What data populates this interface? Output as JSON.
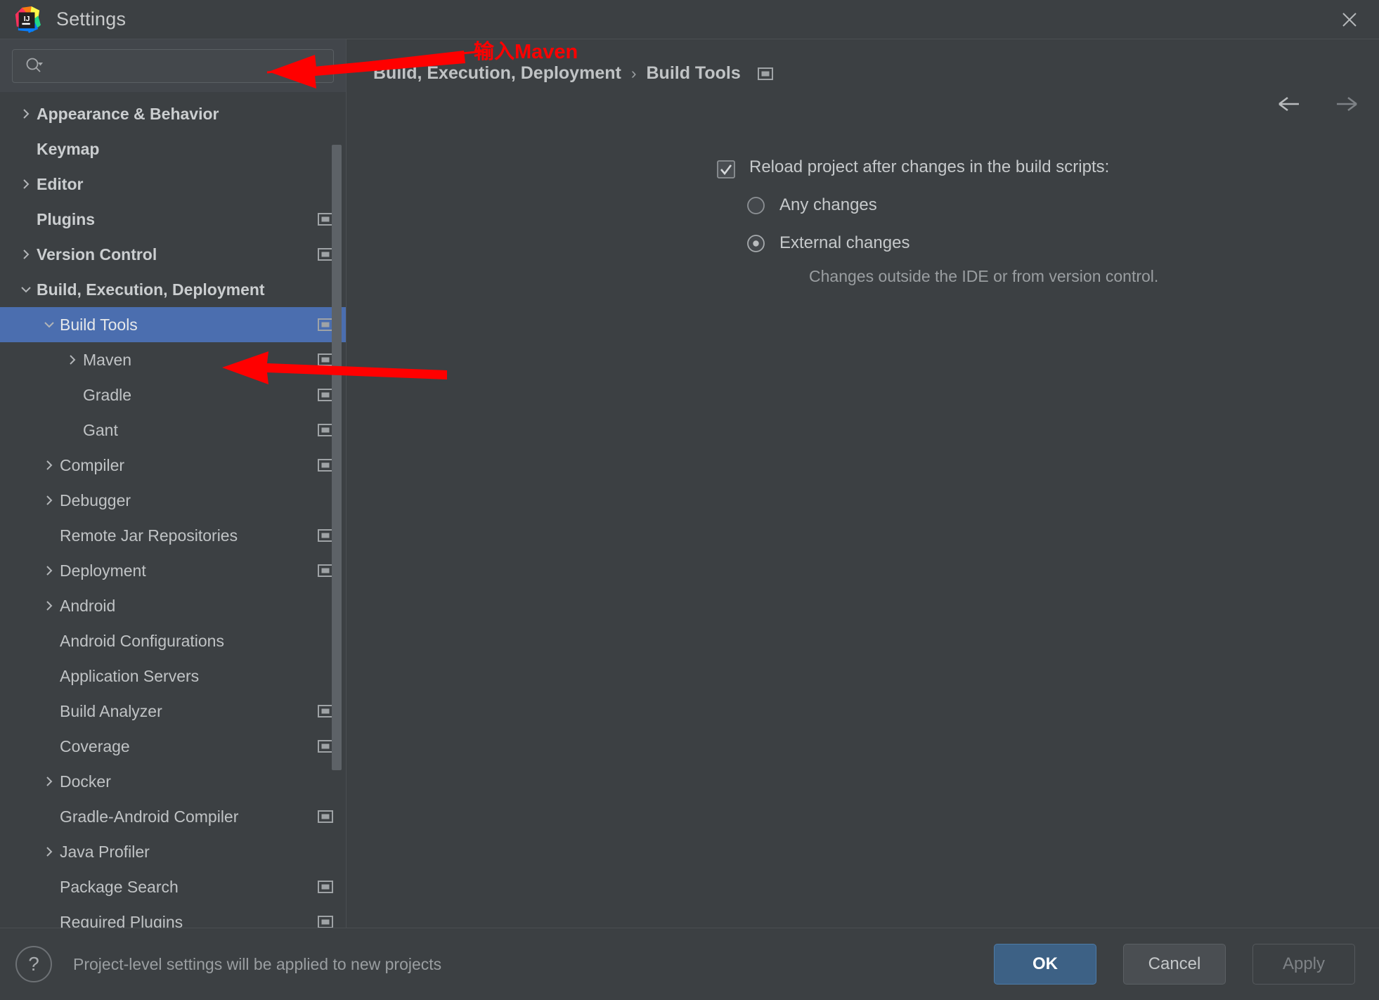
{
  "window": {
    "title": "Settings",
    "logo_icon": "intellij-idea-logo",
    "close_icon": "close-icon"
  },
  "search": {
    "value": "",
    "placeholder": "",
    "icon": "search-icon"
  },
  "sidebar": {
    "scrollbar": "vertical-scrollbar",
    "items": [
      {
        "label": "Appearance & Behavior",
        "level": 0,
        "twisty": "chevron-right",
        "badge": false,
        "selected": false
      },
      {
        "label": "Keymap",
        "level": 0,
        "twisty": "none",
        "badge": false,
        "selected": false
      },
      {
        "label": "Editor",
        "level": 0,
        "twisty": "chevron-right",
        "badge": false,
        "selected": false
      },
      {
        "label": "Plugins",
        "level": 0,
        "twisty": "none",
        "badge": true,
        "selected": false
      },
      {
        "label": "Version Control",
        "level": 0,
        "twisty": "chevron-right",
        "badge": true,
        "selected": false
      },
      {
        "label": "Build, Execution, Deployment",
        "level": 0,
        "twisty": "chevron-down",
        "badge": false,
        "selected": false
      },
      {
        "label": "Build Tools",
        "level": 1,
        "twisty": "chevron-down",
        "badge": true,
        "selected": true
      },
      {
        "label": "Maven",
        "level": 2,
        "twisty": "chevron-right",
        "badge": true,
        "selected": false
      },
      {
        "label": "Gradle",
        "level": 2,
        "twisty": "none",
        "badge": true,
        "selected": false
      },
      {
        "label": "Gant",
        "level": 2,
        "twisty": "none",
        "badge": true,
        "selected": false
      },
      {
        "label": "Compiler",
        "level": 1,
        "twisty": "chevron-right",
        "badge": true,
        "selected": false
      },
      {
        "label": "Debugger",
        "level": 1,
        "twisty": "chevron-right",
        "badge": false,
        "selected": false
      },
      {
        "label": "Remote Jar Repositories",
        "level": 1,
        "twisty": "none",
        "badge": true,
        "selected": false
      },
      {
        "label": "Deployment",
        "level": 1,
        "twisty": "chevron-right",
        "badge": true,
        "selected": false
      },
      {
        "label": "Android",
        "level": 1,
        "twisty": "chevron-right",
        "badge": false,
        "selected": false
      },
      {
        "label": "Android Configurations",
        "level": 1,
        "twisty": "none",
        "badge": false,
        "selected": false
      },
      {
        "label": "Application Servers",
        "level": 1,
        "twisty": "none",
        "badge": false,
        "selected": false
      },
      {
        "label": "Build Analyzer",
        "level": 1,
        "twisty": "none",
        "badge": true,
        "selected": false
      },
      {
        "label": "Coverage",
        "level": 1,
        "twisty": "none",
        "badge": true,
        "selected": false
      },
      {
        "label": "Docker",
        "level": 1,
        "twisty": "chevron-right",
        "badge": false,
        "selected": false
      },
      {
        "label": "Gradle-Android Compiler",
        "level": 1,
        "twisty": "none",
        "badge": true,
        "selected": false
      },
      {
        "label": "Java Profiler",
        "level": 1,
        "twisty": "chevron-right",
        "badge": false,
        "selected": false
      },
      {
        "label": "Package Search",
        "level": 1,
        "twisty": "none",
        "badge": true,
        "selected": false
      },
      {
        "label": "Required Plugins",
        "level": 1,
        "twisty": "none",
        "badge": true,
        "selected": false
      }
    ]
  },
  "breadcrumb": {
    "parent": "Build, Execution, Deployment",
    "separator": "›",
    "current": "Build Tools",
    "badge_icon": "project-level-settings-icon",
    "back_icon": "arrow-left-icon",
    "forward_icon": "arrow-right-icon"
  },
  "content": {
    "reload_checkbox": {
      "label": "Reload project after changes in the build scripts:",
      "checked": true
    },
    "radios": [
      {
        "label": "Any changes",
        "selected": false
      },
      {
        "label": "External changes",
        "selected": true
      }
    ],
    "hint": "Changes outside the IDE or from version control."
  },
  "annotations": {
    "search_note": "输入Maven",
    "color": "#ff0000"
  },
  "footer": {
    "help_icon": "question-mark-icon",
    "note": "Project-level settings will be applied to new projects",
    "ok_label": "OK",
    "cancel_label": "Cancel",
    "apply_label": "Apply",
    "apply_disabled": true
  },
  "colors": {
    "background": "#3c4043",
    "selection": "#4b6eaf",
    "primary_button": "#3d6185",
    "annotation_red": "#ff0000",
    "text": "#c0c3c5",
    "muted_text": "#9a9ea1"
  }
}
